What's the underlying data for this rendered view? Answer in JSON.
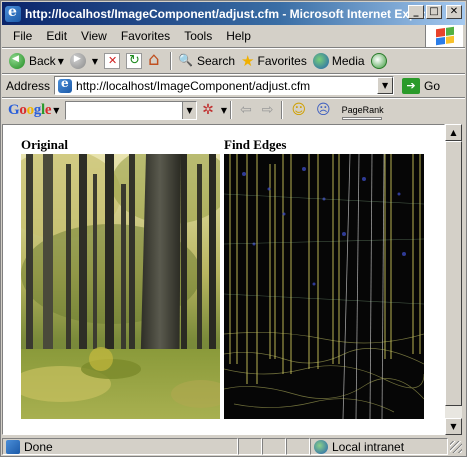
{
  "window": {
    "title": "http://localhost/ImageComponent/adjust.cfm - Microsoft Internet Explorer",
    "minimize_glyph": "_",
    "maximize_glyph": "□",
    "close_glyph": "✕"
  },
  "menu": {
    "items": [
      {
        "label": "File"
      },
      {
        "label": "Edit"
      },
      {
        "label": "View"
      },
      {
        "label": "Favorites"
      },
      {
        "label": "Tools"
      },
      {
        "label": "Help"
      }
    ]
  },
  "toolbar": {
    "back_label": "Back",
    "search_label": "Search",
    "favorites_label": "Favorites",
    "media_label": "Media",
    "dropdown_glyph": "▼"
  },
  "address": {
    "label": "Address",
    "url": "http://localhost/ImageComponent/adjust.cfm",
    "go_label": "Go",
    "go_glyph": "➔"
  },
  "googlebar": {
    "logo_letters": [
      "G",
      "o",
      "o",
      "g",
      "l",
      "e"
    ],
    "search_value": "",
    "pagerank_label": "PageRank"
  },
  "content": {
    "original_caption": "Original",
    "edges_caption": "Find Edges"
  },
  "status": {
    "text": "Done",
    "zone": "Local intranet"
  },
  "colors": {
    "title_gradient_start": "#0a246a",
    "title_gradient_end": "#a6caf0",
    "chrome": "#d4d0c8"
  }
}
